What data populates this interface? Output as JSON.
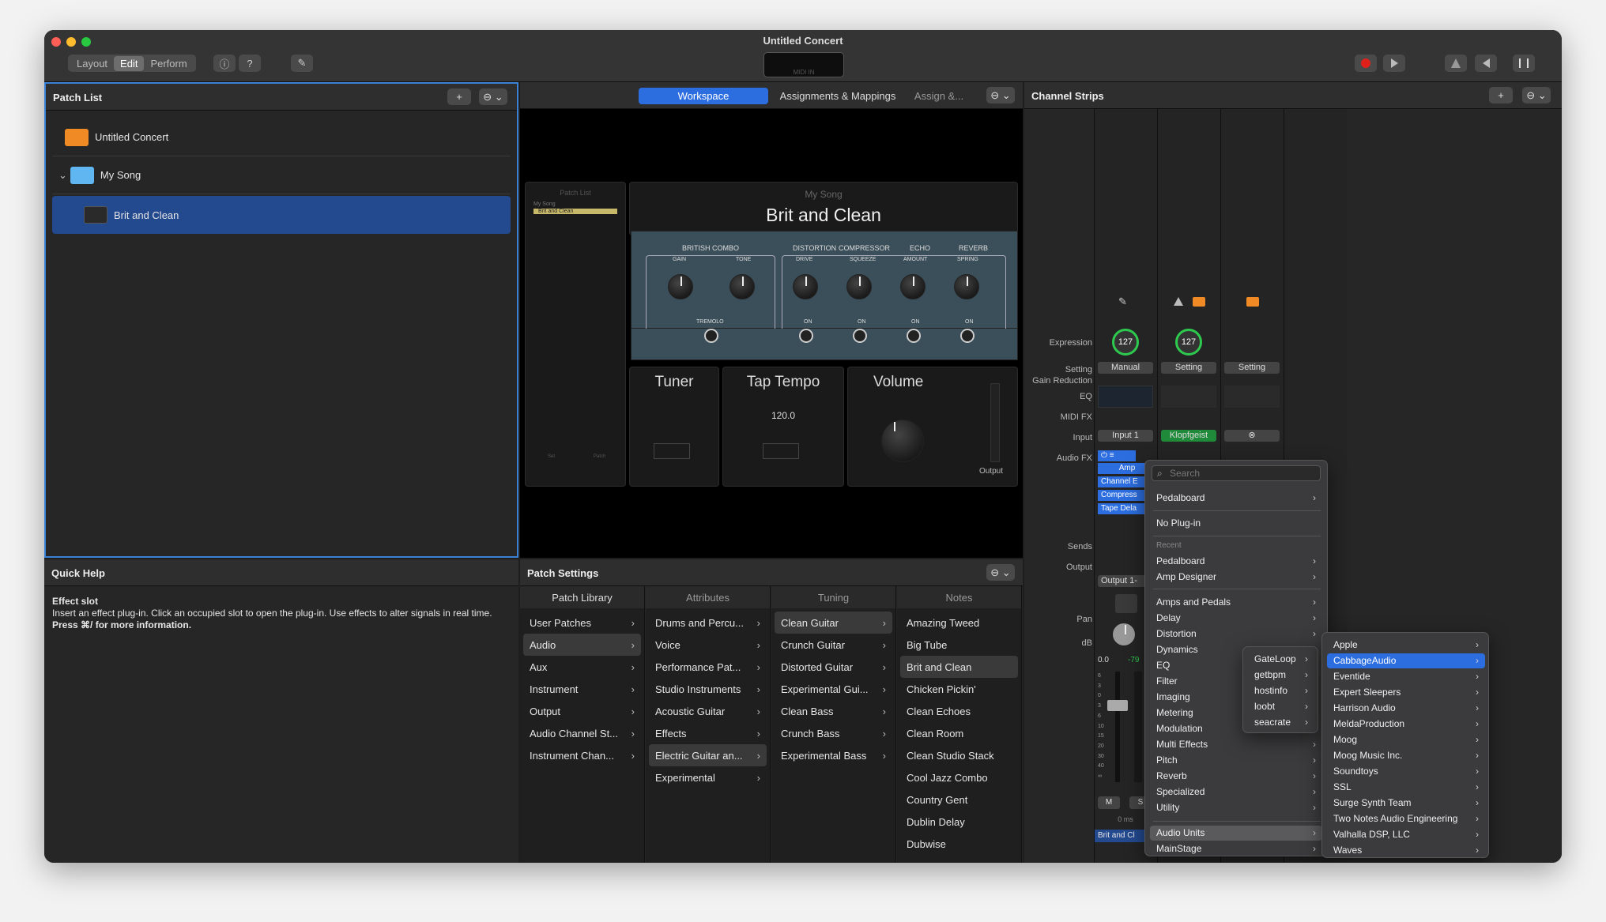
{
  "window": {
    "title": "Untitled Concert",
    "midi_label": "MIDI IN"
  },
  "toolbar": {
    "modes": [
      "Layout",
      "Edit",
      "Perform"
    ],
    "info_glyph": "ⓘ",
    "help_glyph": "?",
    "tuner_glyph": "✎"
  },
  "patch_list": {
    "title": "Patch List",
    "add": "+",
    "menu": "⊖ ⌄",
    "items": [
      {
        "label": "Untitled Concert"
      },
      {
        "label": "My Song"
      },
      {
        "label": "Brit and Clean"
      }
    ]
  },
  "workspace": {
    "tabs": [
      "Workspace",
      "Assignments & Mappings",
      "Assign &..."
    ],
    "menu": "⊖ ⌄",
    "mini_title": "Patch List",
    "mini_song": "My Song",
    "mini_patch": "Brit and Clean",
    "mini_set": "Set",
    "mini_patch_label": "Patch",
    "song": "My Song",
    "patch": "Brit and Clean",
    "amp": {
      "sections": [
        "BRITISH COMBO",
        "DISTORTION",
        "COMPRESSOR",
        "ECHO",
        "REVERB"
      ],
      "knobs": [
        "GAIN",
        "TONE",
        "DRIVE",
        "SQUEEZE",
        "AMOUNT",
        "SPRING"
      ],
      "tremolo": "TREMOLO",
      "on": "ON"
    },
    "tuner": "Tuner",
    "tap_tempo": "Tap Tempo",
    "tempo": "120.0",
    "volume": "Volume",
    "output": "Output"
  },
  "quick_help": {
    "title": "Quick Help",
    "heading": "Effect slot",
    "body": "Insert an effect plug-in. Click an occupied slot to open the plug-in. Use effects to alter signals in real time.",
    "shortcut": "Press ⌘/ for more information."
  },
  "patch_settings": {
    "title": "Patch Settings",
    "menu": "⊖ ⌄",
    "columns": [
      {
        "header": "Patch Library",
        "items": [
          "User Patches",
          "Audio",
          "Aux",
          "Instrument",
          "Output",
          "Audio Channel St...",
          "Instrument Chan..."
        ],
        "selected": 1
      },
      {
        "header": "Attributes",
        "items": [
          "Drums and Percu...",
          "Voice",
          "Performance Pat...",
          "Studio Instruments",
          "Acoustic Guitar",
          "Effects",
          "Electric Guitar an...",
          "Experimental"
        ],
        "selected": 6
      },
      {
        "header": "Tuning",
        "items": [
          "Clean Guitar",
          "Crunch Guitar",
          "Distorted Guitar",
          "Experimental Gui...",
          "Clean Bass",
          "Crunch Bass",
          "Experimental Bass"
        ],
        "selected": 0
      },
      {
        "header": "Notes",
        "items": [
          "Amazing Tweed",
          "Big Tube",
          "Brit and Clean",
          "Chicken Pickin'",
          "Clean Echoes",
          "Clean Room",
          "Clean Studio Stack",
          "Cool Jazz Combo",
          "Country Gent",
          "Dublin Delay",
          "Dubwise"
        ],
        "selected": 2
      }
    ]
  },
  "channel_strips": {
    "title": "Channel Strips",
    "add": "+",
    "menu": "⊖ ⌄",
    "labels": {
      "expression": "Expression",
      "setting": "Setting",
      "gain_reduction": "Gain Reduction",
      "eq": "EQ",
      "midi_fx": "MIDI FX",
      "input": "Input",
      "audio_fx": "Audio FX",
      "sends": "Sends",
      "output": "Output",
      "pan": "Pan",
      "db": "dB"
    },
    "strip1": {
      "expression": "127",
      "setting": "Manual",
      "input": "Input 1",
      "fx": [
        "Amp",
        "Channel E",
        "Compress",
        "Tape Dela"
      ],
      "output": "Output 1-",
      "db": "0.0",
      "peak": "-79",
      "mute": "M",
      "solo": "S",
      "latency": "0 ms",
      "name": "Brit and Cl"
    },
    "strip2": {
      "expression": "127",
      "setting": "Setting",
      "input": "Klopfgeist"
    },
    "strip3": {
      "setting": "Setting",
      "input": "⊗"
    },
    "fader_scale": [
      "6",
      "3",
      "0",
      "3",
      "6",
      "10",
      "15",
      "20",
      "30",
      "40",
      "∞"
    ]
  },
  "plugin_menu": {
    "search_placeholder": "Search",
    "items": [
      "Pedalboard",
      "No Plug-in"
    ],
    "recent_header": "Recent",
    "recent": [
      "Pedalboard",
      "Amp Designer"
    ],
    "categories": [
      "Amps and Pedals",
      "Delay",
      "Distortion",
      "Dynamics",
      "EQ",
      "Filter",
      "Imaging",
      "Metering",
      "Modulation",
      "Multi Effects",
      "Pitch",
      "Reverb",
      "Specialized",
      "Utility"
    ],
    "bottom": [
      "Audio Units",
      "MainStage"
    ]
  },
  "dev_menu": {
    "items": [
      "GateLoop",
      "getbpm",
      "hostinfo",
      "loobt",
      "seacrate"
    ]
  },
  "au_menu": {
    "items": [
      "Apple",
      "CabbageAudio",
      "Eventide",
      "Expert Sleepers",
      "Harrison Audio",
      "MeldaProduction",
      "Moog",
      "Moog Music Inc.",
      "Soundtoys",
      "SSL",
      "Surge Synth Team",
      "Two Notes Audio Engineering",
      "Valhalla DSP, LLC",
      "Waves"
    ],
    "highlighted": 1
  },
  "colors": {
    "accent": "#2c6ee0",
    "selection": "#23498f",
    "green": "#2ec94f",
    "record": "#e0201a"
  }
}
